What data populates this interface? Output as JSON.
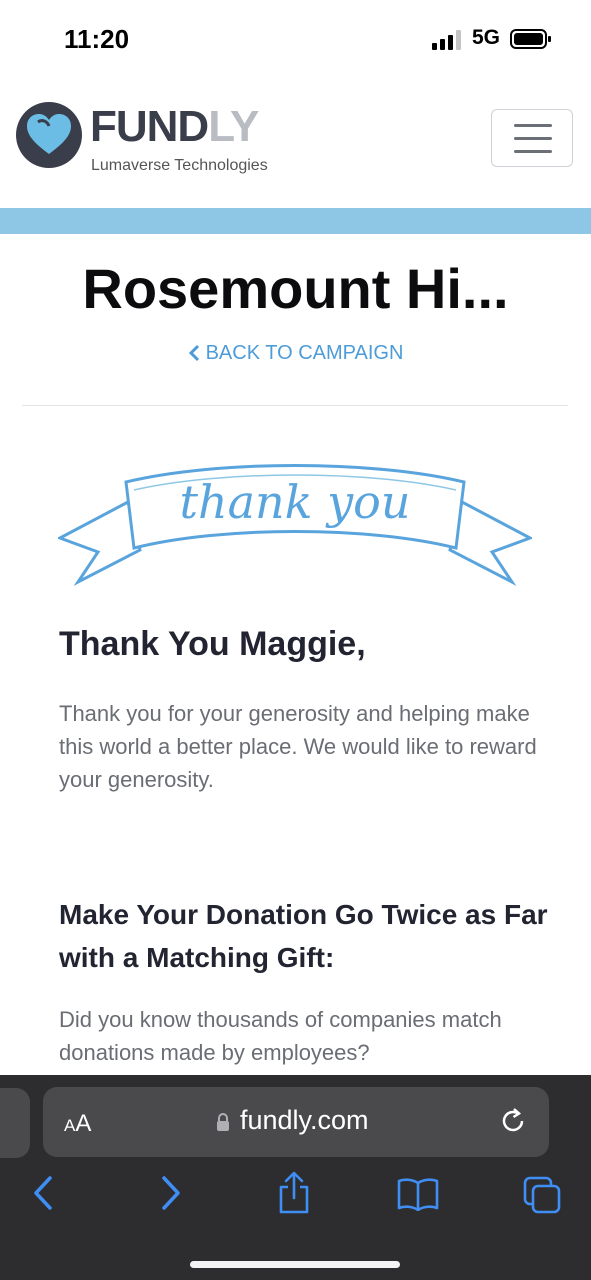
{
  "status_bar": {
    "time": "11:20",
    "network": "5G"
  },
  "header": {
    "brand_part1": "FUND",
    "brand_part2": "LY",
    "tagline": "Lumaverse Technologies",
    "menu_icon": "hamburger-menu-icon"
  },
  "colors": {
    "accent_band": "#8ec7e5",
    "link": "#4d9cd8",
    "heading": "#222431",
    "body_text": "#6a6d73",
    "toolbar_bg": "#2d2d2f"
  },
  "main": {
    "campaign_title": "Rosemount Hi...",
    "back_link": "BACK TO CAMPAIGN",
    "banner_text": "thank you",
    "greeting": "Thank You Maggie,",
    "thank_paragraph": "Thank you for your generosity and helping make this world a better place. We would like to reward your generosity.",
    "matching_heading": "Make Your Donation Go Twice as Far with a Matching Gift:",
    "matching_paragraph": "Did you know thousands of companies match donations made by employees?"
  },
  "browser": {
    "aa_small": "A",
    "aa_large": "A",
    "url": "fundly.com",
    "icons": [
      "back-icon",
      "forward-icon",
      "share-icon",
      "bookmarks-icon",
      "tabs-icon"
    ]
  }
}
